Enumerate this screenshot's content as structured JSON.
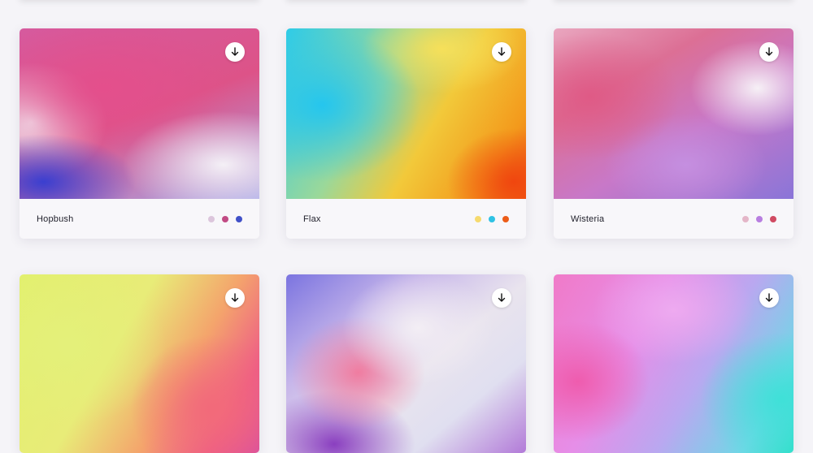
{
  "cards": [
    {
      "name": "Hopbush",
      "colors": [
        "#dcc6dc",
        "#c14a84",
        "#4050c8"
      ],
      "gradient": "g-hopbush"
    },
    {
      "name": "Flax",
      "colors": [
        "#f6da6e",
        "#2fc2e4",
        "#ec5c18"
      ],
      "gradient": "g-flax"
    },
    {
      "name": "Wisteria",
      "colors": [
        "#e4b6c8",
        "#b87ee0",
        "#d04a62"
      ],
      "gradient": "g-wisteria"
    },
    {
      "name": "",
      "colors": [],
      "gradient": "g-lime"
    },
    {
      "name": "",
      "colors": [],
      "gradient": "g-violet"
    },
    {
      "name": "",
      "colors": [],
      "gradient": "g-aqua"
    }
  ],
  "icons": {
    "download": "arrow-down-icon"
  }
}
